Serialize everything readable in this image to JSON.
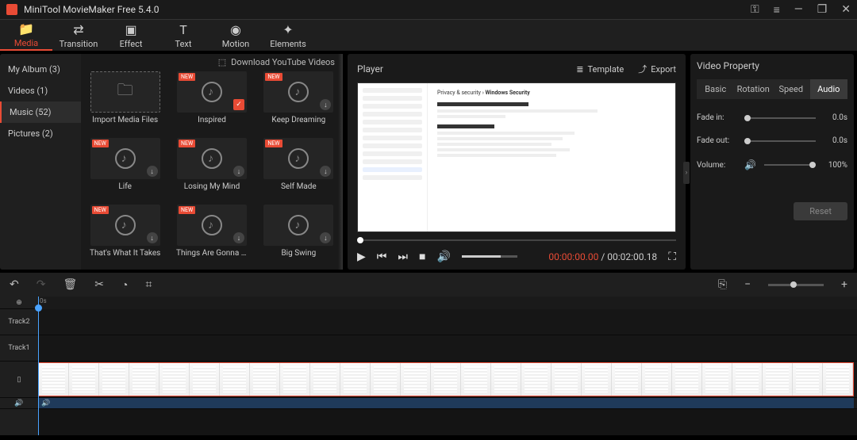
{
  "app": {
    "title": "MiniTool MovieMaker Free 5.4.0"
  },
  "toolbar": {
    "media": "Media",
    "transition": "Transition",
    "effect": "Effect",
    "text": "Text",
    "motion": "Motion",
    "elements": "Elements"
  },
  "library": {
    "categories": [
      {
        "label": "My Album (3)"
      },
      {
        "label": "Videos (1)"
      },
      {
        "label": "Music (52)"
      },
      {
        "label": "Pictures (2)"
      }
    ],
    "download_yt": "Download YouTube Videos",
    "tiles": [
      {
        "label": "Import Media Files",
        "import": true
      },
      {
        "label": "Inspired",
        "new": true,
        "checked": true
      },
      {
        "label": "Keep Dreaming",
        "new": true,
        "dl": true
      },
      {
        "label": "Life",
        "new": true,
        "dl": true
      },
      {
        "label": "Losing My Mind",
        "new": true,
        "dl": true
      },
      {
        "label": "Self Made",
        "new": true,
        "dl": true
      },
      {
        "label": "That's What It Takes",
        "new": true,
        "dl": true
      },
      {
        "label": "Things Are Gonna Ge…",
        "new": true,
        "dl": true
      },
      {
        "label": "Big Swing",
        "dl": true
      }
    ]
  },
  "player": {
    "title": "Player",
    "template": "Template",
    "export": "Export",
    "time_current": "00:00:00.00",
    "time_sep": " / ",
    "time_total": "00:02:00.18",
    "preview": {
      "crumb1": "Privacy & security  ›  ",
      "crumb2": "Windows Security"
    }
  },
  "props": {
    "title": "Video Property",
    "tabs": {
      "basic": "Basic",
      "rotation": "Rotation",
      "speed": "Speed",
      "audio": "Audio"
    },
    "fade_in_label": "Fade in:",
    "fade_in_val": "0.0s",
    "fade_out_label": "Fade out:",
    "fade_out_val": "0.0s",
    "volume_label": "Volume:",
    "volume_val": "100%",
    "reset": "Reset"
  },
  "timeline": {
    "ruler0": "0s",
    "track2": "Track2",
    "track1": "Track1"
  }
}
